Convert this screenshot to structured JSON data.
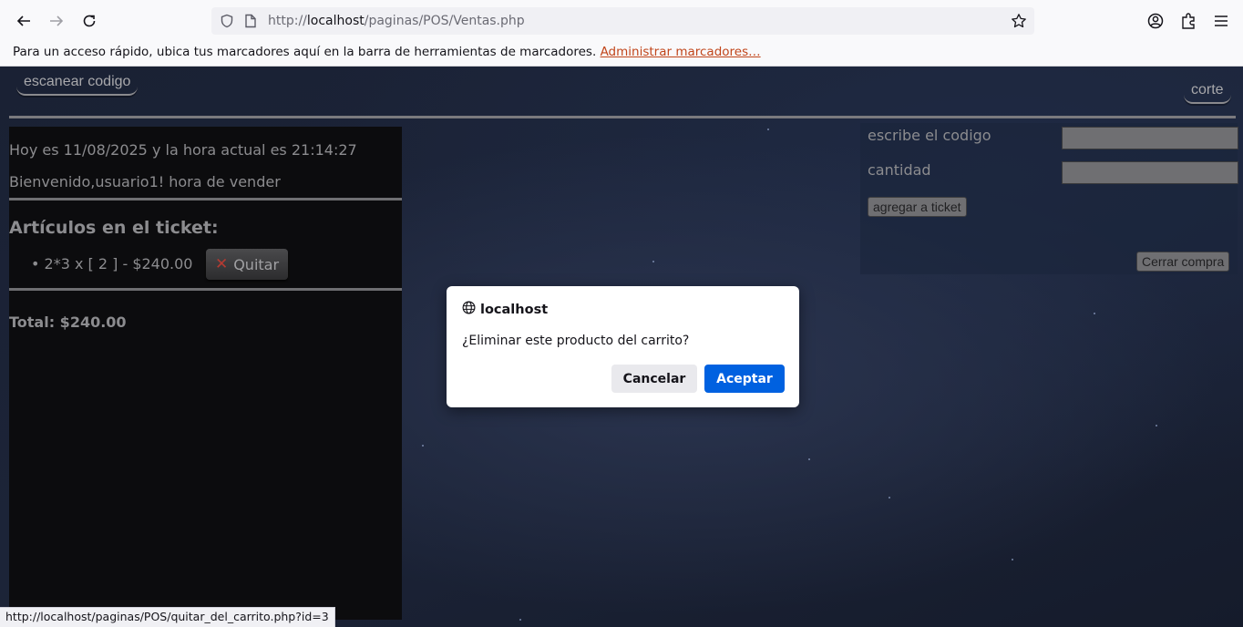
{
  "browser": {
    "url_scheme": "http://",
    "url_host": "localhost",
    "url_path": "/paginas/POS/Ventas.php",
    "bookmarks_message": "Para un acceso rápido, ubica tus marcadores aquí en la barra de herramientas de marcadores.",
    "bookmarks_link": "Administrar marcadores…",
    "status_url": "http://localhost/paginas/POS/quitar_del_carrito.php?id=3",
    "icons": [
      "back-icon",
      "forward-icon",
      "reload-icon",
      "shield-icon",
      "page-info-icon",
      "bookmark-star-icon",
      "account-icon",
      "extensions-icon",
      "menu-icon"
    ]
  },
  "header": {
    "scan_label": "escanear codigo",
    "corte_label": "corte"
  },
  "left_panel": {
    "date_line": "Hoy es 11/08/2025 y la hora actual es 21:14:27",
    "welcome_line": "Bienvenido,usuario1! hora de vender",
    "ticket_title": "Artículos en el ticket:",
    "items": [
      {
        "text": "2*3 x [ 2 ] - $240.00",
        "remove_label": "Quitar"
      }
    ],
    "total": "Total: $240.00"
  },
  "form": {
    "code_label": "escribe el codigo",
    "code_value": "",
    "qty_label": "cantidad",
    "qty_value": "",
    "add_button": "agregar a ticket",
    "close_button": "Cerrar compra"
  },
  "dialog": {
    "title": "localhost",
    "message": "¿Eliminar este producto del carrito?",
    "cancel": "Cancelar",
    "accept": "Aceptar"
  },
  "colors": {
    "accept_button": "#0061e0",
    "bookmark_link": "#c1451a",
    "panel_bg": "#0c0c0e"
  }
}
